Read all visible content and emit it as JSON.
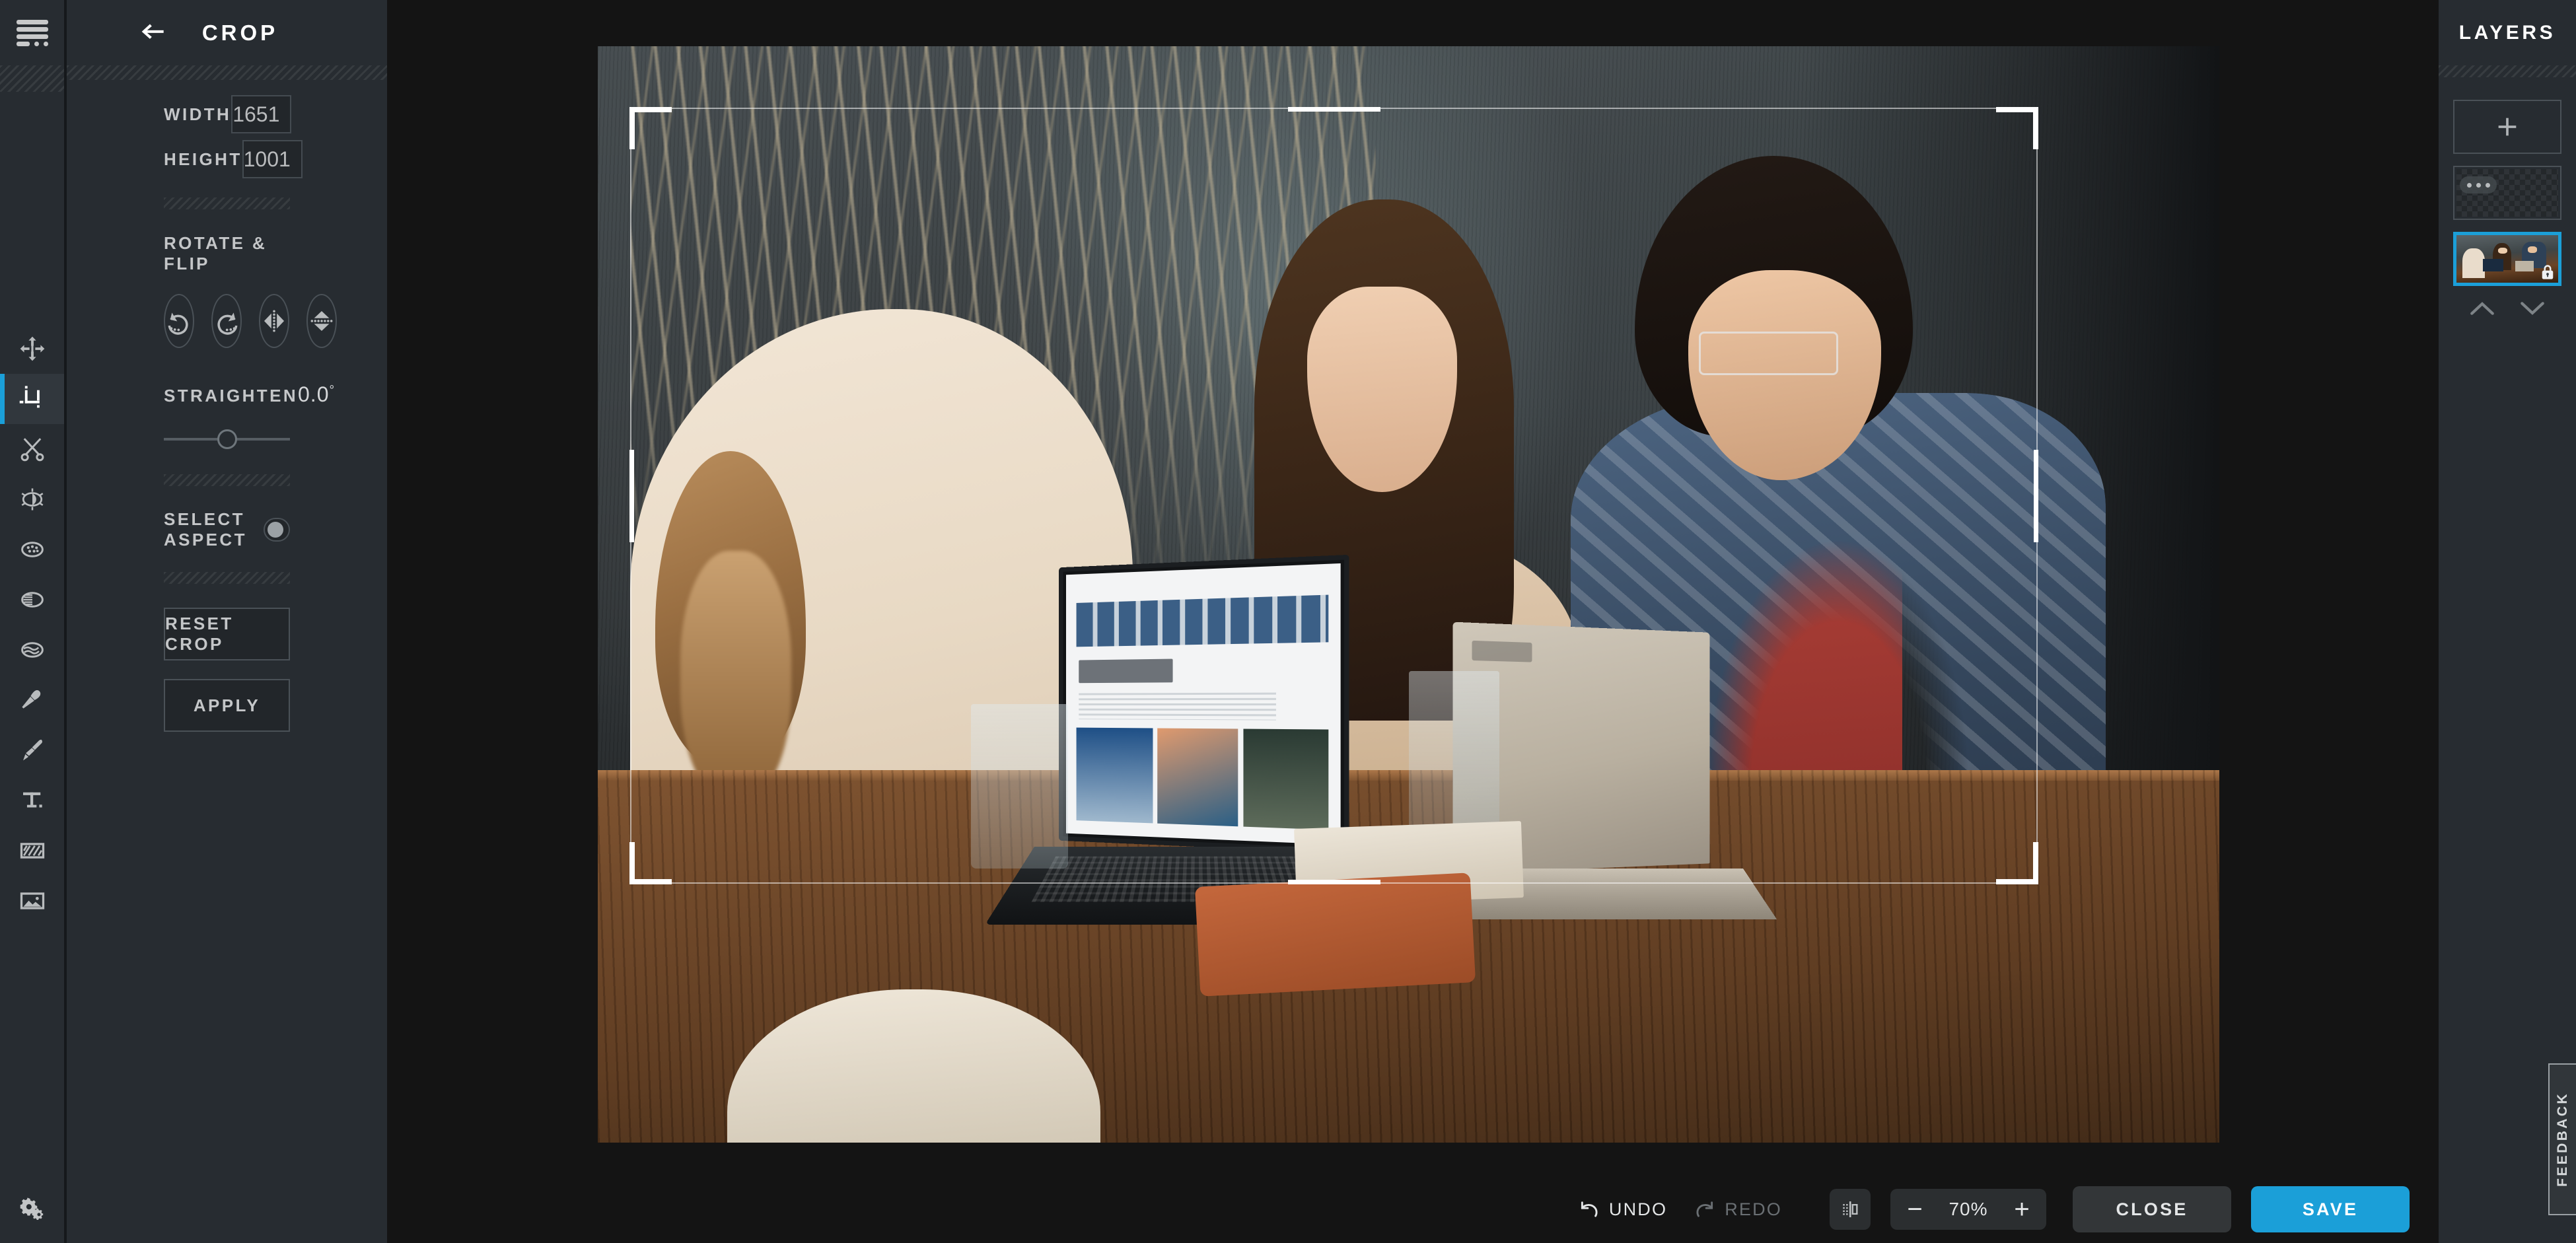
{
  "app": {
    "accent_color": "#1b9fd8",
    "panel_bg": "#272c31",
    "canvas_bg": "#141414"
  },
  "rail": {
    "menu_icon": "hamburger-menu-icon",
    "settings_icon": "settings-gears-icon",
    "tools": [
      {
        "name": "transform",
        "icon": "move-arrows-icon",
        "active": false
      },
      {
        "name": "crop",
        "icon": "crop-icon",
        "active": true
      },
      {
        "name": "cut",
        "icon": "scissors-icon",
        "active": false
      },
      {
        "name": "adjust",
        "icon": "brightness-contrast-icon",
        "active": false
      },
      {
        "name": "effects",
        "icon": "texture-dots-icon",
        "active": false
      },
      {
        "name": "gradient",
        "icon": "gradient-icon",
        "active": false
      },
      {
        "name": "liquify",
        "icon": "waves-icon",
        "active": false
      },
      {
        "name": "retouch",
        "icon": "makeup-brush-icon",
        "active": false
      },
      {
        "name": "paint",
        "icon": "paintbrush-icon",
        "active": false
      },
      {
        "name": "text",
        "icon": "text-t-icon",
        "active": false
      },
      {
        "name": "overlay",
        "icon": "pattern-frame-icon",
        "active": false
      },
      {
        "name": "image",
        "icon": "picture-icon",
        "active": false
      }
    ]
  },
  "panel": {
    "title": "CROP",
    "back_icon": "back-arrow-icon",
    "width_label": "WIDTH",
    "width_value": "1651",
    "height_label": "HEIGHT",
    "height_value": "1001",
    "rotate_flip_label": "ROTATE & FLIP",
    "rotate_flip_buttons": [
      {
        "name": "rotate-left",
        "icon": "rotate-counterclockwise-icon"
      },
      {
        "name": "rotate-right",
        "icon": "rotate-clockwise-icon"
      },
      {
        "name": "flip-horizontal",
        "icon": "flip-horizontal-icon"
      },
      {
        "name": "flip-vertical",
        "icon": "flip-vertical-icon"
      }
    ],
    "straighten_label": "STRAIGHTEN",
    "straighten_value": "0.0",
    "straighten_unit": "°",
    "select_aspect_label": "SELECT ASPECT",
    "select_aspect_on": false,
    "reset_label": "RESET CROP",
    "apply_label": "APPLY"
  },
  "canvas": {
    "crop_overlay": "crop-selection-rectangle",
    "image_description": "three people seated at a wooden cafe table with two laptops"
  },
  "bottombar": {
    "undo_label": "UNDO",
    "undo_enabled": true,
    "redo_label": "REDO",
    "redo_enabled": false,
    "compare_icon": "compare-split-icon",
    "zoom_out": "−",
    "zoom_value": "70%",
    "zoom_in": "+",
    "close_label": "CLOSE",
    "save_label": "SAVE"
  },
  "layers": {
    "title": "LAYERS",
    "add_icon": "plus-icon",
    "items": [
      {
        "name": "layer-empty",
        "type": "transparent",
        "selected": false,
        "locked": false,
        "badge": "•••"
      },
      {
        "name": "layer-photo",
        "type": "image",
        "selected": true,
        "locked": true,
        "badge": ""
      }
    ],
    "move_up_icon": "chevron-up-icon",
    "move_down_icon": "chevron-down-icon"
  },
  "feedback": {
    "label": "FEEDBACK"
  }
}
